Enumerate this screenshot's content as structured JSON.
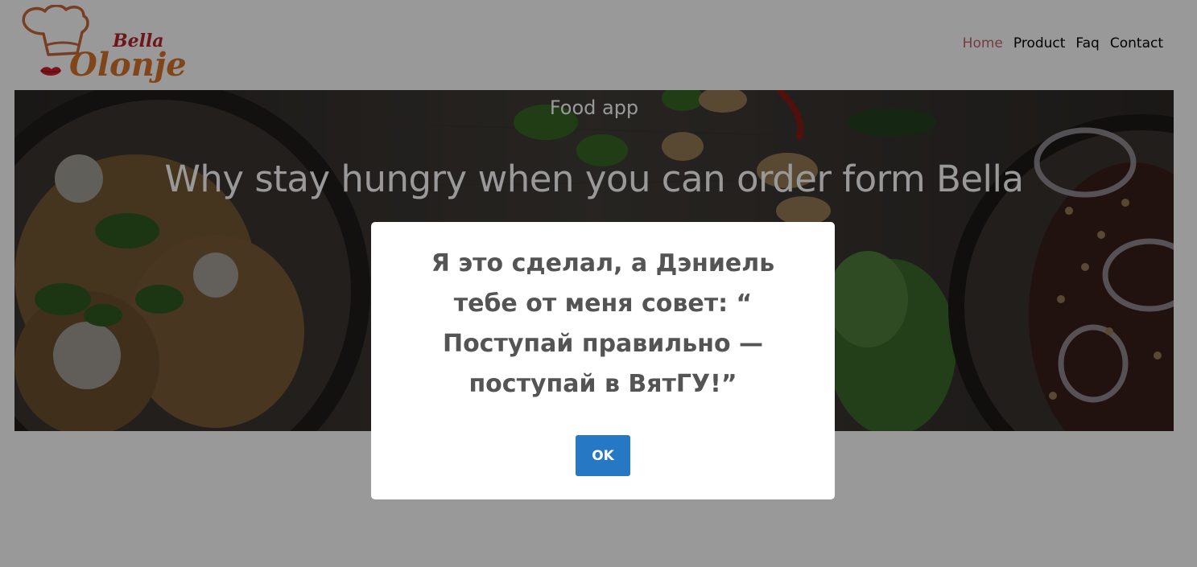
{
  "brand": {
    "logo_text_top": "Bella",
    "logo_text_main": "Olonje",
    "colors": {
      "hat": "#c9683c",
      "text_top": "#b8232f",
      "text_main": "#d8732c",
      "lips": "#d31f2a"
    }
  },
  "nav": {
    "items": [
      {
        "label": "Home",
        "active": true
      },
      {
        "label": "Product",
        "active": false
      },
      {
        "label": "Faq",
        "active": false
      },
      {
        "label": "Contact",
        "active": false
      }
    ],
    "active_color": "#c0676b"
  },
  "hero": {
    "subtitle": "Food app",
    "title": "Why stay hungry when you can order form Bella"
  },
  "modal": {
    "message": "Я это сделал, а Дэниель тебе от меня совет: “ Поступай правильно — поступай в ВятГУ!”",
    "ok_label": "OK",
    "ok_color": "#2778c4"
  }
}
